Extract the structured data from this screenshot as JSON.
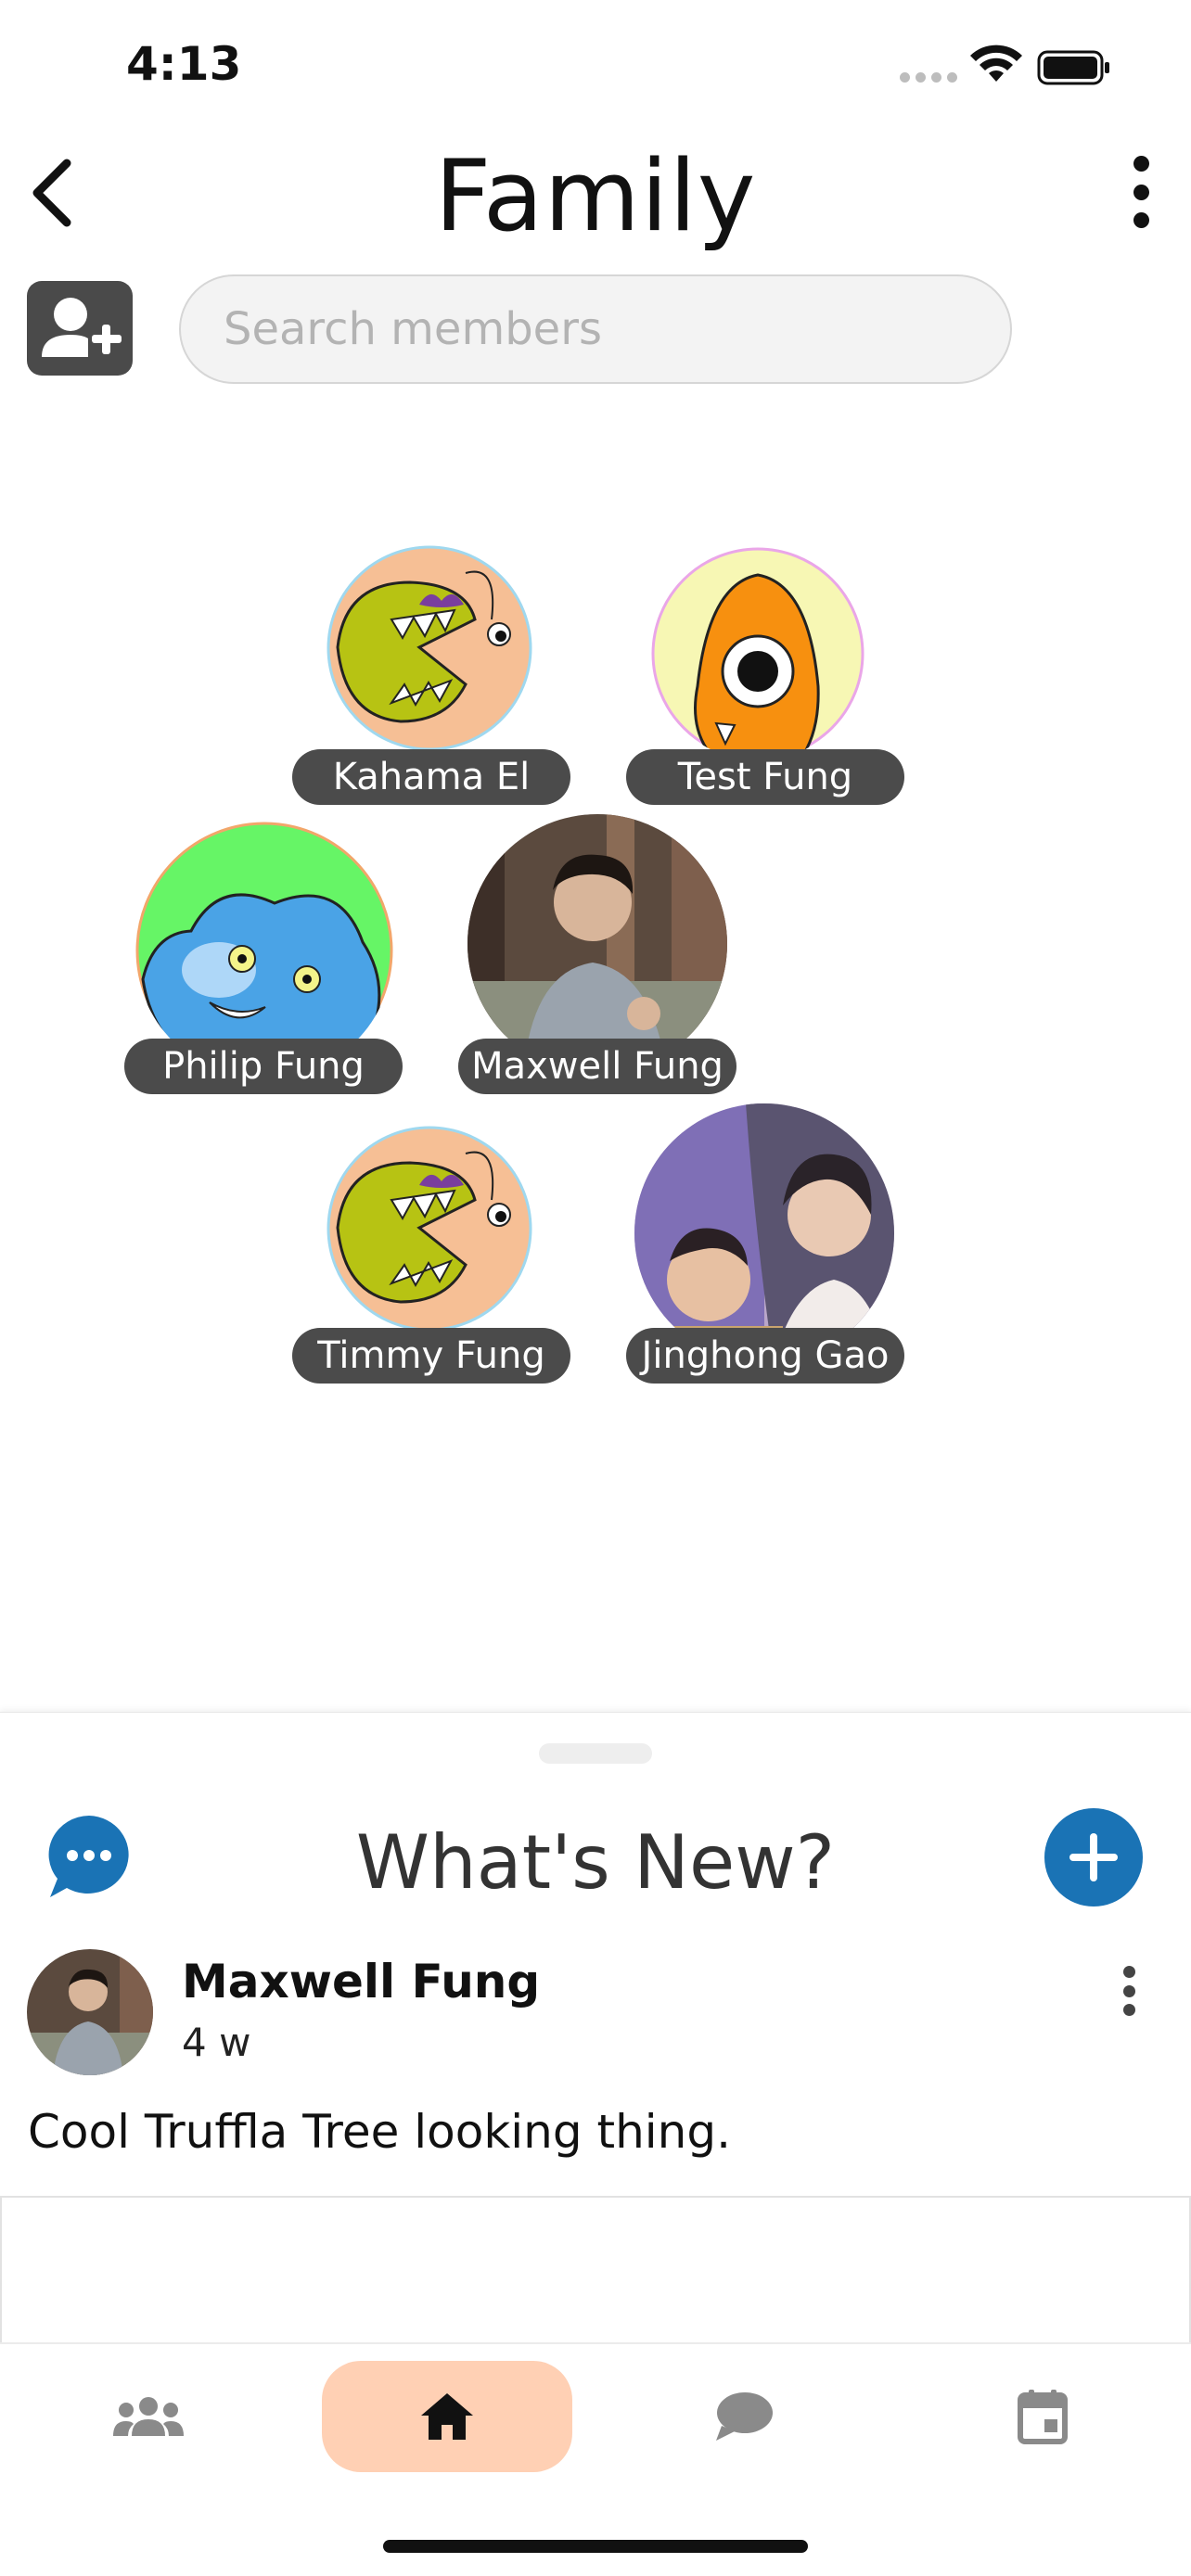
{
  "status_bar": {
    "time": "4:13"
  },
  "header": {
    "title": "Family"
  },
  "search": {
    "placeholder": "Search members"
  },
  "members": [
    {
      "name": "Kahama El",
      "avatar": "monster-green-icon"
    },
    {
      "name": "Test Fung",
      "avatar": "monster-orange-icon"
    },
    {
      "name": "Philip Fung",
      "avatar": "monster-blue-icon"
    },
    {
      "name": "Maxwell Fung",
      "avatar": "photo"
    },
    {
      "name": "Timmy Fung",
      "avatar": "monster-green-icon"
    },
    {
      "name": "Jinghong Gao",
      "avatar": "photo"
    }
  ],
  "whats_new": {
    "title": "What's New?",
    "post": {
      "author": "Maxwell Fung",
      "time": "4 w",
      "text": "Cool Truffla Tree looking thing."
    }
  },
  "nav": {
    "active": "home",
    "items": [
      "family-icon",
      "home-icon",
      "chat-icon",
      "calendar-icon"
    ]
  },
  "colors": {
    "accent_blue": "#1a73b5",
    "nav_active_bg": "#ffd0b4",
    "pill_bg": "#4b4b4b",
    "icon_grey": "#8a8a8a"
  }
}
